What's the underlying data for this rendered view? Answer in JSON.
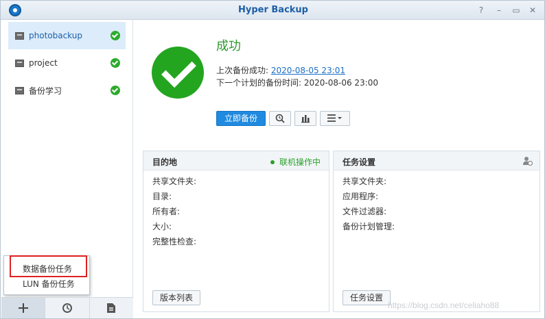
{
  "window": {
    "title": "Hyper Backup"
  },
  "sidebar": {
    "tasks": [
      {
        "label": "photobackup",
        "status": "ok"
      },
      {
        "label": "project",
        "status": "ok"
      },
      {
        "label": "备份学习",
        "status": "ok"
      }
    ],
    "popup_menu": [
      "数据备份任务",
      "LUN 备份任务"
    ],
    "toolbar_icons": [
      "plus-icon",
      "history-icon",
      "log-icon"
    ]
  },
  "main": {
    "status_title": "成功",
    "last_backup_label": "上次备份成功:",
    "last_backup_value": "2020-08-05 23:01",
    "next_backup_label": "下一个计划的备份时间:",
    "next_backup_value": "2020-08-06 23:00",
    "backup_now_label": "立即备份"
  },
  "destination_panel": {
    "title": "目的地",
    "status": "联机操作中",
    "rows": [
      "共享文件夹:",
      "目录:",
      "所有者:",
      "大小:",
      "完整性检查:"
    ],
    "button_label": "版本列表"
  },
  "task_panel": {
    "title": "任务设置",
    "rows": [
      "共享文件夹:",
      "应用程序:",
      "文件过滤器:",
      "备份计划管理:"
    ],
    "button_label": "任务设置"
  },
  "watermark": "https://blog.csdn.net/celiaho88",
  "colors": {
    "accent": "#1f8ae0",
    "success": "#23a520",
    "title": "#1c5fa8"
  }
}
